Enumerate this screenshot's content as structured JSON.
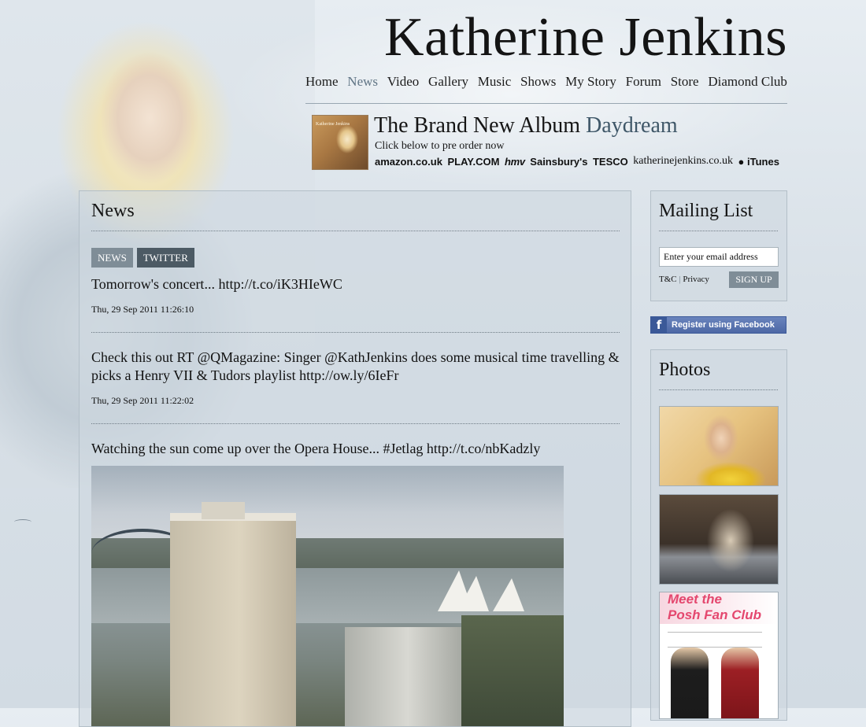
{
  "site": {
    "title": "Katherine Jenkins"
  },
  "nav": {
    "items": [
      {
        "label": "Home"
      },
      {
        "label": "News"
      },
      {
        "label": "Video"
      },
      {
        "label": "Gallery"
      },
      {
        "label": "Music"
      },
      {
        "label": "Shows"
      },
      {
        "label": "My Story"
      },
      {
        "label": "Forum"
      },
      {
        "label": "Store"
      },
      {
        "label": "Diamond Club"
      }
    ],
    "active": "News"
  },
  "promo": {
    "title_prefix": "The Brand New Album",
    "album_name": "Daydream",
    "subtitle": "Click below to pre order now",
    "cover_text": "Katherine Jenkins",
    "retailers": [
      "amazon.co.uk",
      "PLAY.COM",
      "hmv",
      "Sainsbury's",
      "TESCO",
      "katherinejenkins.co.uk",
      "iTunes"
    ]
  },
  "news": {
    "heading": "News",
    "tabs": [
      {
        "label": "NEWS"
      },
      {
        "label": "TWITTER"
      }
    ],
    "posts": [
      {
        "text": "Tomorrow's concert... http://t.co/iK3HIeWC",
        "date": "Thu, 29 Sep 2011 11:26:10"
      },
      {
        "text": "Check this out RT @QMagazine: Singer @KathJenkins does some musical time travelling & picks a Henry VII & Tudors playlist http://ow.ly/6IeFr",
        "date": "Thu, 29 Sep 2011 11:22:02"
      },
      {
        "text": "Watching the sun come up over the Opera House... #Jetlag http://t.co/nbKadzly"
      }
    ]
  },
  "mailing": {
    "heading": "Mailing List",
    "placeholder": "Enter your email address",
    "terms": "T&C",
    "separator": "|",
    "privacy": "Privacy",
    "signup": "SIGN UP"
  },
  "facebook": {
    "label": "Register using Facebook",
    "glyph": "f"
  },
  "photos": {
    "heading": "Photos",
    "magazine_line1": "Meet the",
    "magazine_line2": "Posh Fan Club"
  },
  "colors": {
    "accent": "#617586",
    "tab_dark": "#4c5a64",
    "tab_light": "#7f8d97",
    "facebook": "#3b5998"
  }
}
